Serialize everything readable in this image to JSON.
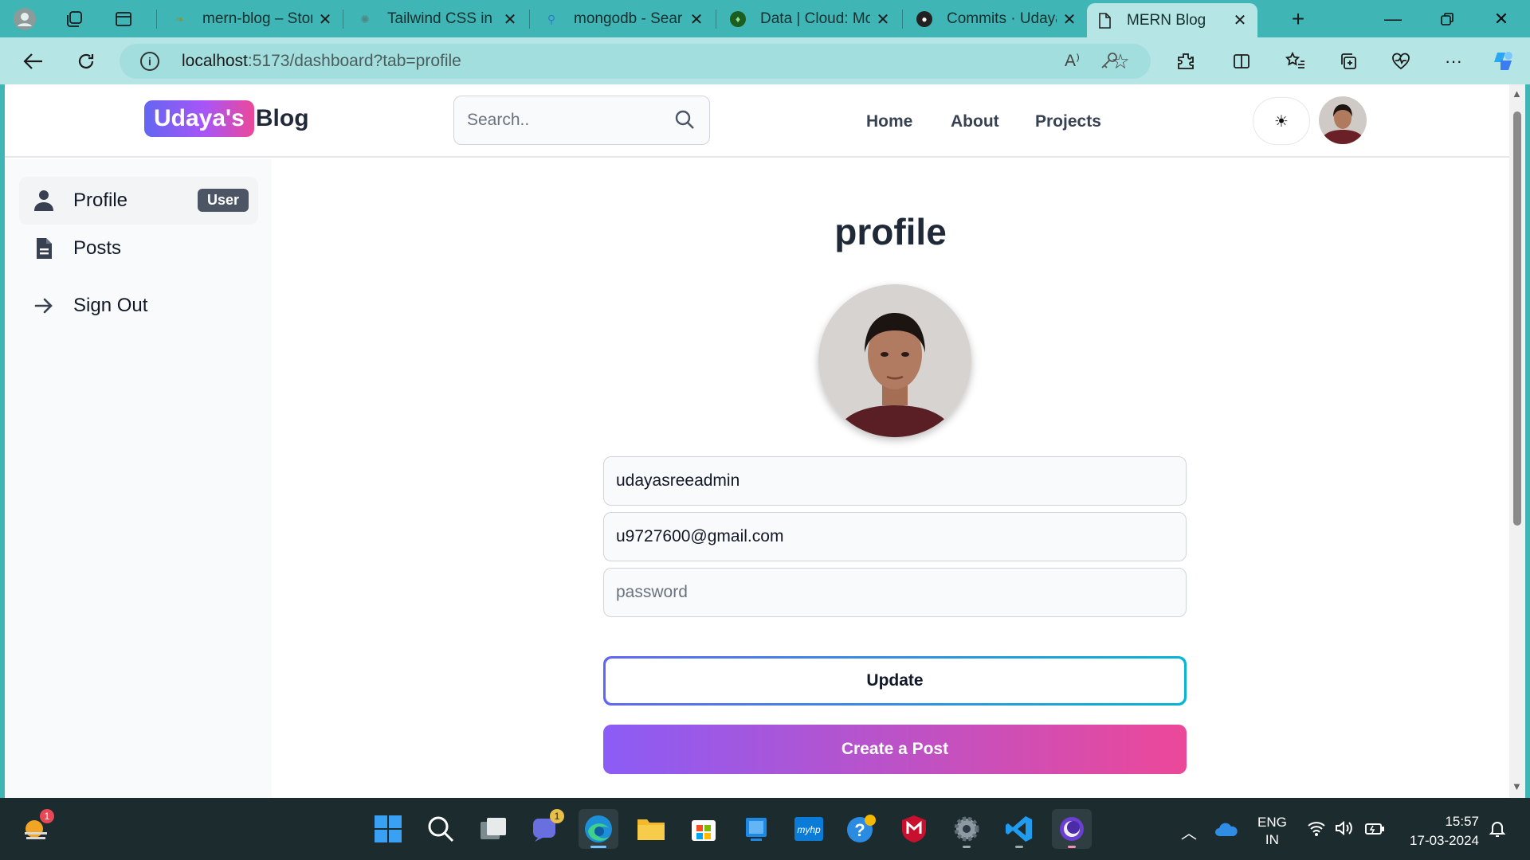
{
  "browser": {
    "tabs": [
      {
        "title": "mern-blog – Stor",
        "color": "#7d9b4a"
      },
      {
        "title": "Tailwind CSS in N",
        "color": "#5c8d8c"
      },
      {
        "title": "mongodb - Sear",
        "color": "#2b7bd1"
      },
      {
        "title": "Data | Cloud: Mo",
        "color": "#1b5e20"
      },
      {
        "title": "Commits · Udaya",
        "color": "#222222"
      },
      {
        "title": "MERN Blog",
        "color": "#ffffff"
      }
    ],
    "address": {
      "host": "localhost",
      "path": ":5173/dashboard?tab=profile"
    }
  },
  "site": {
    "logo_highlight": "Udaya's",
    "logo_rest": "Blog",
    "search_placeholder": "Search..",
    "nav": [
      "Home",
      "About",
      "Projects"
    ],
    "theme_toggle": "☀"
  },
  "sidebar": {
    "items": [
      {
        "label": "Profile",
        "badge": "User"
      },
      {
        "label": "Posts"
      },
      {
        "label": "Sign Out"
      }
    ]
  },
  "profile": {
    "title": "profile",
    "username": "udayasreeadmin",
    "email": "u9727600@gmail.com",
    "password_placeholder": "password",
    "update_label": "Update",
    "create_label": "Create a Post"
  },
  "taskbar": {
    "weather_badge": "1",
    "teams_badge": "1",
    "language_line1": "ENG",
    "language_line2": "IN",
    "time": "15:57",
    "date": "17-03-2024"
  },
  "colors": {
    "accent_teal": "#3fb6b5",
    "gradient_start": "#8b5cf6",
    "gradient_end": "#ec4899"
  }
}
